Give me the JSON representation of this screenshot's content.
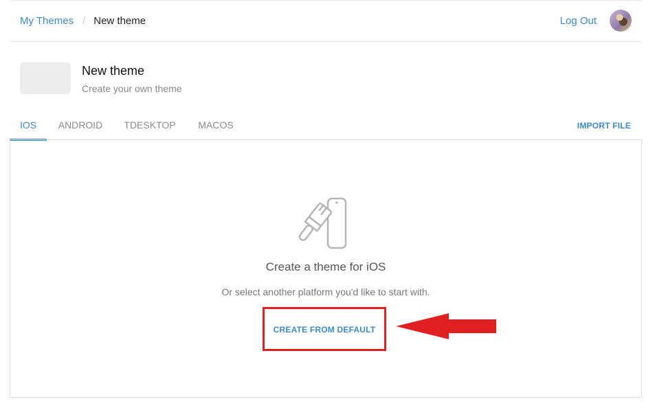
{
  "breadcrumb": {
    "parent": "My Themes",
    "separator": "/",
    "current": "New theme"
  },
  "header": {
    "logout_label": "Log Out",
    "avatar_icon": "user-avatar"
  },
  "theme": {
    "title": "New theme",
    "subtitle": "Create your own theme"
  },
  "tabs": [
    {
      "label": "IOS",
      "active": true
    },
    {
      "label": "ANDROID",
      "active": false
    },
    {
      "label": "TDESKTOP",
      "active": false
    },
    {
      "label": "MACOS",
      "active": false
    }
  ],
  "import_label": "IMPORT FILE",
  "empty_state": {
    "icon": "paint-brush-phone-icon",
    "title": "Create a theme for iOS",
    "subtitle": "Or select another platform you'd like to start with.",
    "button_label": "CREATE FROM DEFAULT"
  },
  "colors": {
    "accent": "#3a8bc8",
    "highlight": "#e02020"
  }
}
